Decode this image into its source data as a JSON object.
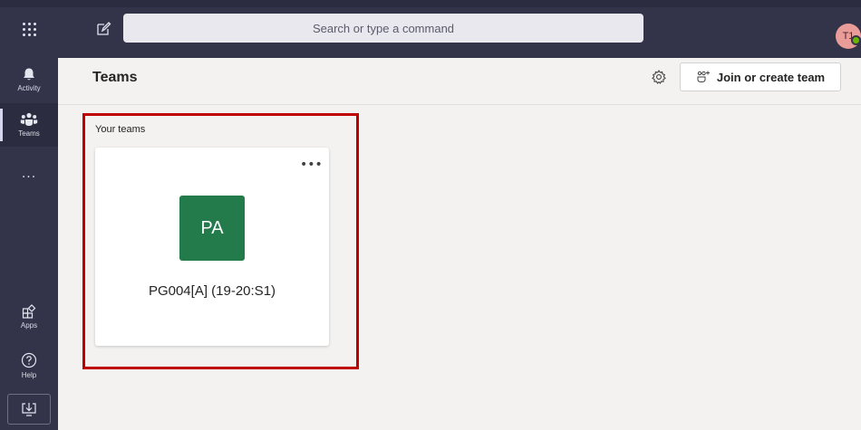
{
  "topbar": {
    "search_placeholder": "Search or type a command",
    "user_initials": "T1",
    "presence": "available"
  },
  "rail": {
    "items": [
      {
        "label": "Activity",
        "icon": "bell-icon"
      },
      {
        "label": "Teams",
        "icon": "teams-icon",
        "active": true
      },
      {
        "label": "Apps",
        "icon": "apps-icon"
      },
      {
        "label": "Help",
        "icon": "help-icon"
      }
    ],
    "more_label": "..."
  },
  "header": {
    "title": "Teams",
    "join_label": "Join or create team"
  },
  "main": {
    "section_label": "Your teams",
    "teams": [
      {
        "initials": "PA",
        "name": "PG004[A] (19-20:S1)",
        "color": "#237b4b"
      }
    ]
  },
  "colors": {
    "rail_bg": "#33344a",
    "highlight": "#c00000"
  }
}
